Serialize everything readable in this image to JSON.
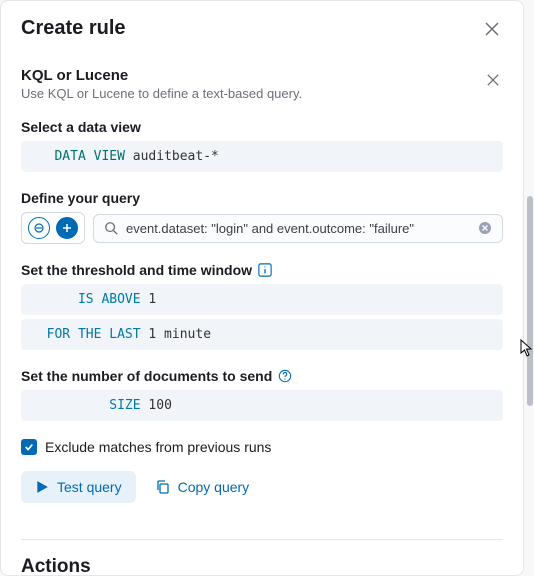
{
  "header": {
    "title": "Create rule"
  },
  "query_type": {
    "title": "KQL or Lucene",
    "description": "Use KQL or Lucene to define a text-based query."
  },
  "data_view": {
    "label": "Select a data view",
    "keyword": "DATA VIEW",
    "value": "auditbeat-*"
  },
  "query": {
    "label": "Define your query",
    "value": "event.dataset: \"login\" and event.outcome: \"failure\""
  },
  "threshold": {
    "label": "Set the threshold and time window",
    "is_above_kw": "IS ABOVE",
    "is_above_val": "1",
    "for_last_kw": "FOR THE LAST",
    "for_last_val": "1 minute"
  },
  "documents": {
    "label": "Set the number of documents to send",
    "size_kw": "SIZE",
    "size_val": "100"
  },
  "exclude": {
    "checked": true,
    "label": "Exclude matches from previous runs"
  },
  "buttons": {
    "test": "Test query",
    "copy": "Copy query"
  },
  "actions": {
    "title": "Actions"
  }
}
